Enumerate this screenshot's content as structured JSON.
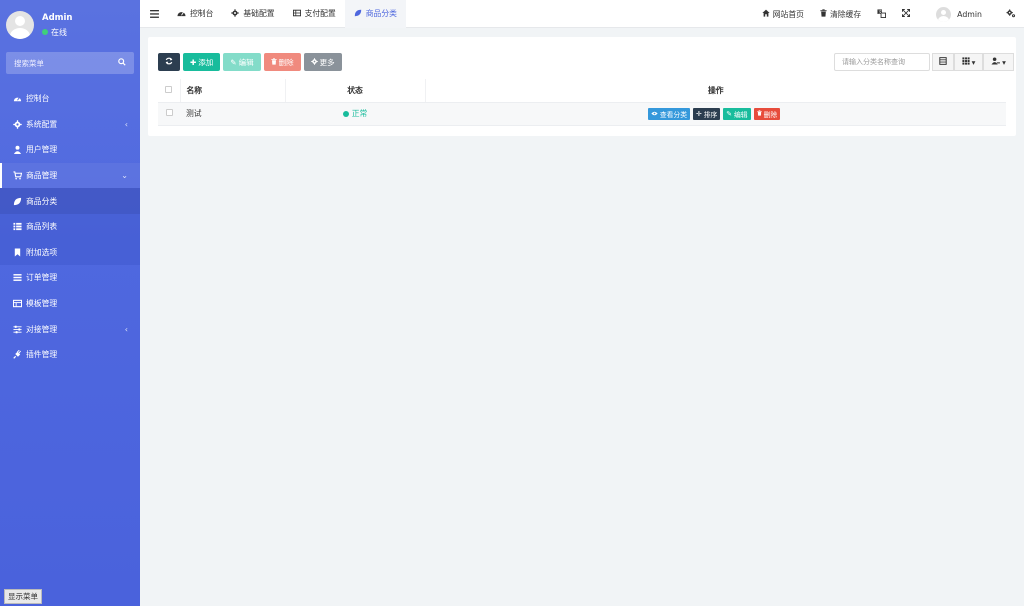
{
  "sidebar": {
    "user_name": "Admin",
    "user_status": "在线",
    "search_placeholder": "搜索菜单",
    "items": [
      {
        "label": "控制台",
        "icon": "dashboard-icon"
      },
      {
        "label": "系统配置",
        "icon": "gear-icon",
        "chevron": "‹"
      },
      {
        "label": "用户管理",
        "icon": "user-icon"
      },
      {
        "label": "商品管理",
        "icon": "cart-icon",
        "chevron": "⌄"
      },
      {
        "label": "商品分类",
        "icon": "leaf-icon"
      },
      {
        "label": "商品列表",
        "icon": "list-icon"
      },
      {
        "label": "附加选项",
        "icon": "bookmark-icon"
      },
      {
        "label": "订单管理",
        "icon": "bars-icon"
      },
      {
        "label": "模板管理",
        "icon": "template-icon"
      },
      {
        "label": "对接管理",
        "icon": "sliders-icon",
        "chevron": "‹"
      },
      {
        "label": "插件管理",
        "icon": "plug-icon"
      }
    ],
    "show_menu_label": "显示菜单"
  },
  "topbar": {
    "tabs": [
      {
        "label": "控制台",
        "icon": "dashboard-icon"
      },
      {
        "label": "基础配置",
        "icon": "gear-icon"
      },
      {
        "label": "支付配置",
        "icon": "table-icon"
      },
      {
        "label": "商品分类",
        "icon": "leaf-icon"
      }
    ],
    "site_home": "网站首页",
    "clear_cache": "清除缓存",
    "admin_name": "Admin"
  },
  "toolbar": {
    "add": "添加",
    "edit": "编辑",
    "delete": "删除",
    "more": "更多",
    "search_placeholder": "请输入分类名称查询"
  },
  "table": {
    "headers": [
      "名称",
      "状态",
      "操作"
    ],
    "rows": [
      {
        "name": "测试",
        "status": "正常",
        "ops": [
          "查看分类",
          "排序",
          "编辑",
          "删除"
        ]
      }
    ]
  },
  "colors": {
    "sidebar": "#4f68df",
    "accent": "#4e67de",
    "green": "#18bc9c",
    "dark": "#2c3e50",
    "red": "#e74c3c",
    "blue": "#3498db"
  }
}
